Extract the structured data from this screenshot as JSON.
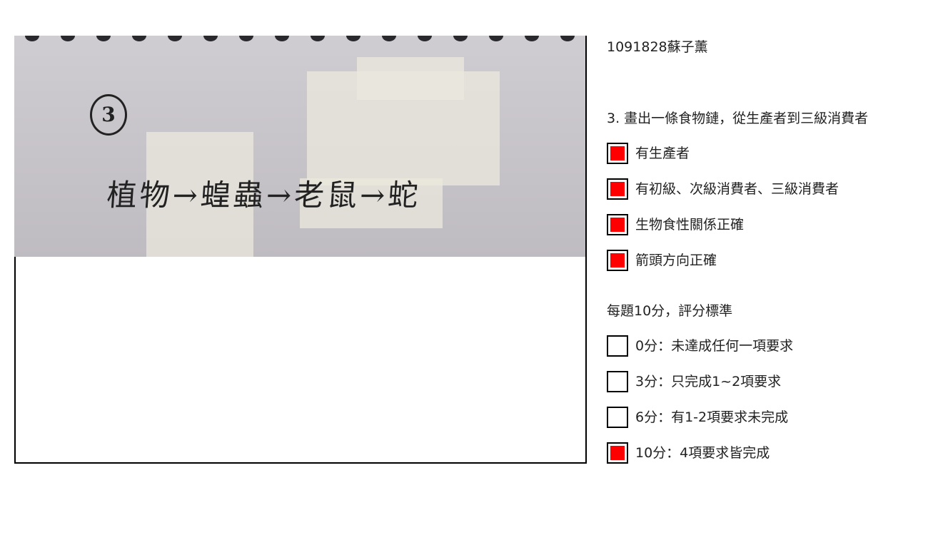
{
  "student": "1091828蘇子薰",
  "photo": {
    "circled_number": "3",
    "handwriting": "植物→蝗蟲→老鼠→蛇"
  },
  "question": "3. 畫出一條食物鏈，從生產者到三級消費者",
  "criteria": [
    {
      "label": "有生產者",
      "checked": true
    },
    {
      "label": "有初級、次級消費者、三級消費者",
      "checked": true
    },
    {
      "label": "生物食性關係正確",
      "checked": true
    },
    {
      "label": "箭頭方向正確",
      "checked": true
    }
  ],
  "scoring_title": "每題10分，評分標準",
  "scores": [
    {
      "label": "0分：未達成任何一項要求",
      "checked": false
    },
    {
      "label": "3分：只完成1~2項要求",
      "checked": false
    },
    {
      "label": "6分：有1-2項要求未完成",
      "checked": false
    },
    {
      "label": "10分：4項要求皆完成",
      "checked": true
    }
  ],
  "colors": {
    "checked_fill": "#ff0000",
    "border": "#000000"
  }
}
